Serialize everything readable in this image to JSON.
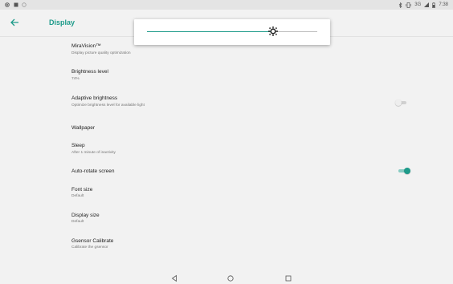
{
  "status_bar": {
    "time": "7:38",
    "network": "3G",
    "left_icons": [
      "record-icon",
      "image-icon",
      "vpn-icon"
    ],
    "right_icons": [
      "bluetooth-icon",
      "vibrate-icon",
      "signal-icon",
      "battery-icon"
    ]
  },
  "toolbar": {
    "title": "Display",
    "back_icon": "arrow-left-icon"
  },
  "brightness_popup": {
    "level": 0.74,
    "thumb_icon": "brightness-icon"
  },
  "settings": [
    {
      "title": "MiraVision™",
      "summary": "Display picture quality optimization"
    },
    {
      "title": "Brightness level",
      "summary": "74%"
    },
    {
      "title": "Adaptive brightness",
      "summary": "Optimize brightness level for available light",
      "toggle": false
    },
    {
      "title": "Wallpaper",
      "summary": ""
    },
    {
      "title": "Sleep",
      "summary": "After 1 minute of inactivity"
    },
    {
      "title": "Auto-rotate screen",
      "summary": "",
      "toggle": true
    },
    {
      "title": "Font size",
      "summary": "Default"
    },
    {
      "title": "Display size",
      "summary": "Default"
    },
    {
      "title": "Gsensor Calibrate",
      "summary": "Calibrate the gsensor"
    }
  ],
  "colors": {
    "accent": "#1e9b8a",
    "background": "#f2f2f2",
    "switch_off_track": "#d0d0d0",
    "switch_off_knob": "#eeeeee"
  },
  "nav_bar": {
    "back_icon": "triangle-back-icon",
    "home_icon": "circle-home-icon",
    "recents_icon": "square-recents-icon"
  }
}
